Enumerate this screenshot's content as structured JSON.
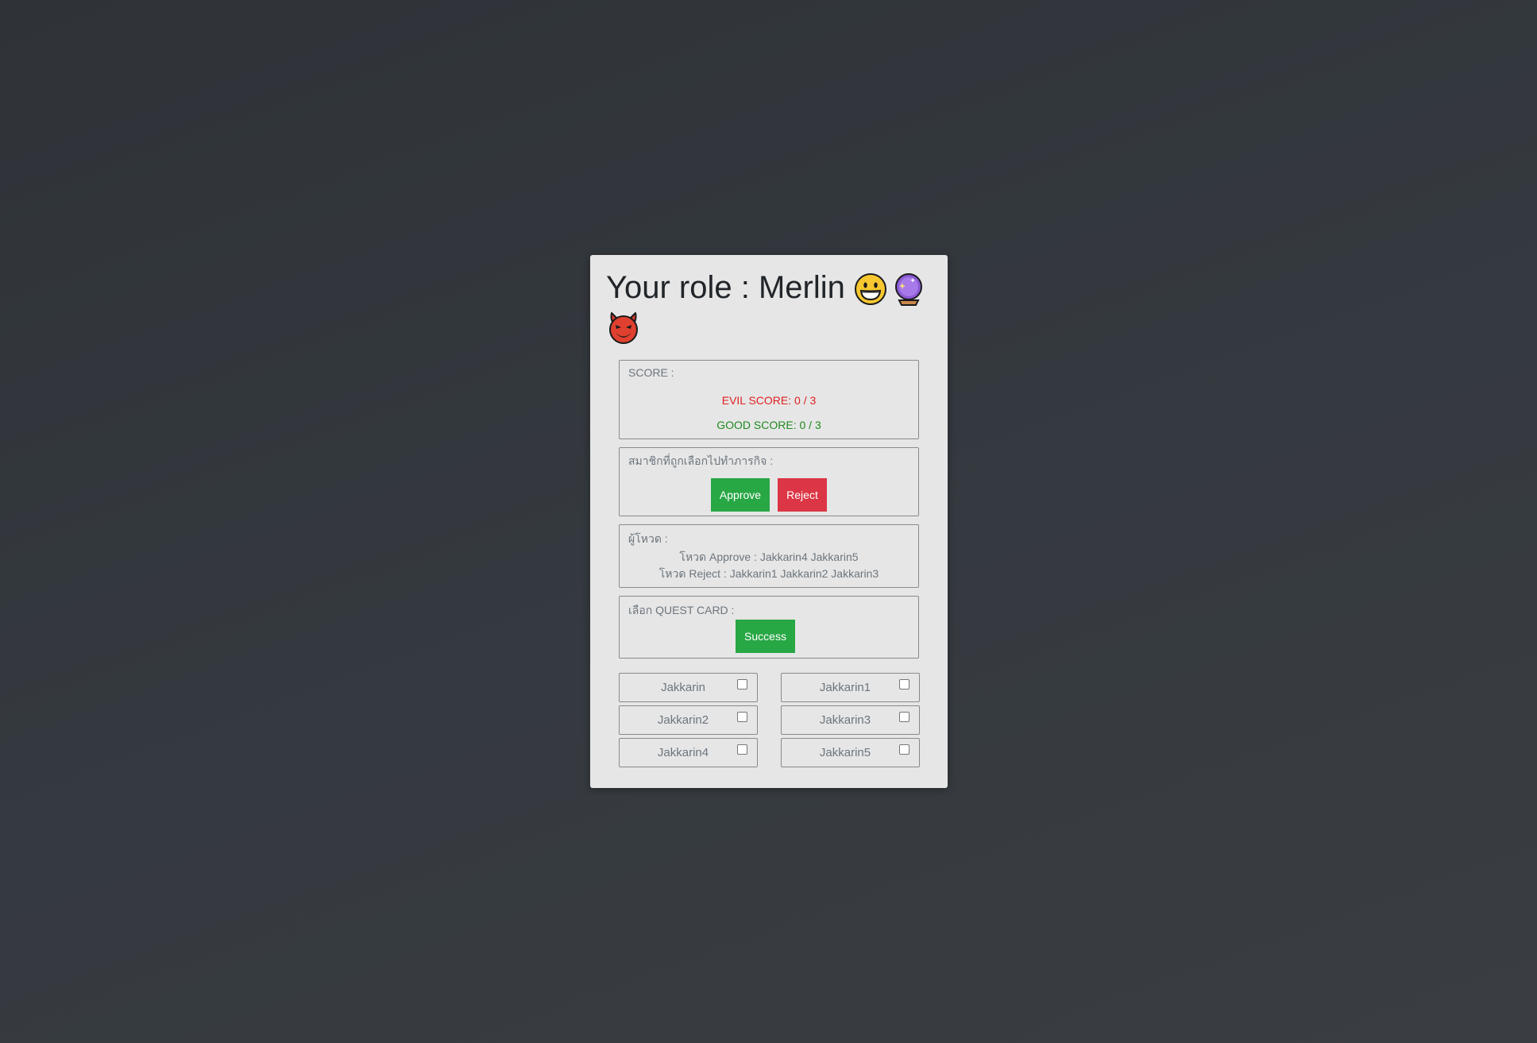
{
  "title": {
    "text": "Your role : Merlin",
    "icons": [
      "grinning-face-icon",
      "crystal-ball-icon",
      "smiling-devil-icon"
    ]
  },
  "score": {
    "label": "SCORE :",
    "evil": "EVIL SCORE: 0 / 3",
    "good": "GOOD SCORE: 0 / 3",
    "colors": {
      "evil": "#e02020",
      "good": "#1f8a1f"
    }
  },
  "team": {
    "label": "สมาชิกที่ถูกเลือกไปทำภารกิจ :",
    "approve_label": "Approve",
    "reject_label": "Reject",
    "colors": {
      "approve": "#28a745",
      "reject": "#dc3545"
    }
  },
  "voters": {
    "label": "ผู้โหวด :",
    "approve_line": "โหวด Approve : Jakkarin4 Jakkarin5",
    "reject_line": "โหวด Reject : Jakkarin1 Jakkarin2 Jakkarin3"
  },
  "quest": {
    "label": "เลือก QUEST CARD :",
    "success_label": "Success"
  },
  "players": [
    {
      "name": "Jakkarin",
      "checked": false
    },
    {
      "name": "Jakkarin1",
      "checked": false
    },
    {
      "name": "Jakkarin2",
      "checked": false
    },
    {
      "name": "Jakkarin3",
      "checked": false
    },
    {
      "name": "Jakkarin4",
      "checked": false
    },
    {
      "name": "Jakkarin5",
      "checked": false
    }
  ]
}
